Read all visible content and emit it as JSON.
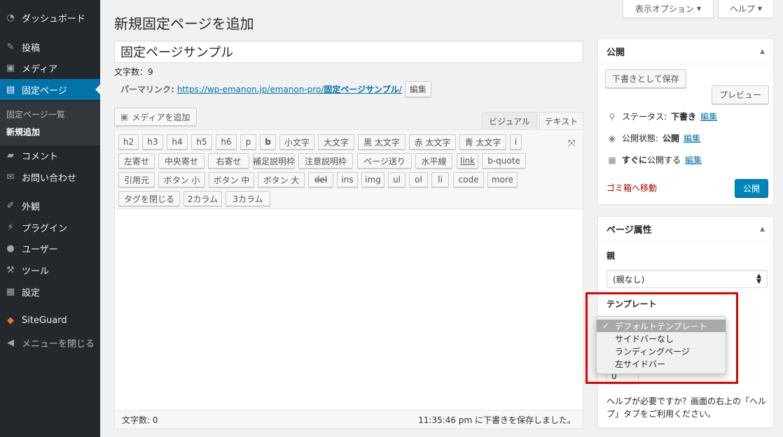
{
  "sidebar": {
    "items": [
      {
        "label": "ダッシュボード",
        "icon": "dashboard-icon",
        "glyph": "◔"
      },
      {
        "label": "投稿",
        "icon": "pin-icon",
        "glyph": "✎"
      },
      {
        "label": "メディア",
        "icon": "media-icon",
        "glyph": "▣"
      },
      {
        "label": "固定ページ",
        "icon": "page-icon",
        "glyph": "▤"
      },
      {
        "label": "コメント",
        "icon": "comment-icon",
        "glyph": "▰"
      },
      {
        "label": "お問い合わせ",
        "icon": "mail-icon",
        "glyph": "✉"
      },
      {
        "label": "外観",
        "icon": "brush-icon",
        "glyph": "✐"
      },
      {
        "label": "プラグイン",
        "icon": "plugin-icon",
        "glyph": "⚡"
      },
      {
        "label": "ユーザー",
        "icon": "user-icon",
        "glyph": "●"
      },
      {
        "label": "ツール",
        "icon": "wrench-icon",
        "glyph": "⚒"
      },
      {
        "label": "設定",
        "icon": "settings-icon",
        "glyph": "▦"
      },
      {
        "label": "SiteGuard",
        "icon": "siteguard-icon",
        "glyph": "◆"
      },
      {
        "label": "メニューを閉じる",
        "icon": "collapse-icon",
        "glyph": "◀"
      }
    ],
    "submenu": [
      "固定ページ一覧",
      "新規追加"
    ]
  },
  "screen_options": {
    "label": "表示オプション",
    "arrow": "▼"
  },
  "help": {
    "label": "ヘルプ",
    "arrow": "▼"
  },
  "page_title": "新規固定ページを追加",
  "post_title": "固定ページサンプル",
  "char_count_top": "文字数：9",
  "permalink": {
    "label": "パーマリンク:",
    "url_base": "https://wp-emanon.jp/emanon-pro/",
    "slug": "固定ページサンプル",
    "url_end": "/",
    "edit_label": "編集"
  },
  "media_button": "メディアを追加",
  "tabs": {
    "visual": "ビジュアル",
    "text": "テキスト"
  },
  "quicktags": {
    "row1": [
      "h2",
      "h3",
      "h4",
      "h5",
      "h6",
      "p",
      "b",
      "小文字",
      "大文字",
      "黒 太文字",
      "赤 太文字",
      "青 太文字",
      "i"
    ],
    "row2": [
      "左寄せ",
      "中央寄せ",
      "右寄せ",
      "補足説明枠",
      "注意説明枠",
      "ページ送り",
      "水平線",
      "link",
      "b-quote"
    ],
    "row3": [
      "引用元",
      "ボタン 小",
      "ボタン 中",
      "ボタン 大",
      "del",
      "ins",
      "img",
      "ul",
      "ol",
      "li",
      "code",
      "more"
    ],
    "row4": [
      "タグを閉じる",
      "2カラム",
      "3カラム"
    ]
  },
  "status_bar": {
    "word_count": "文字数: 0",
    "saved": "11:35:46 pm に下書きを保存しました。"
  },
  "publish_box": {
    "title": "公開",
    "save_draft": "下書きとして保存",
    "preview": "プレビュー",
    "status_label": "ステータス:",
    "status_value": "下書き",
    "visibility_label": "公開状態:",
    "visibility_value": "公開",
    "schedule_pre": "すぐに",
    "schedule_post": "公開する",
    "edit": "編集",
    "trash": "ゴミ箱へ移動",
    "publish": "公開"
  },
  "attributes_box": {
    "title": "ページ属性",
    "parent_label": "親",
    "parent_value": "(親なし)",
    "template_label": "テンプレート",
    "template_options": [
      "デフォルトテンプレート",
      "サイドバーなし",
      "ランディングページ",
      "左サイドバー"
    ],
    "selected_template": "デフォルトテンプレート",
    "order_value": "0",
    "help_text": "ヘルプが必要ですか？画面の右上の「ヘルプ」タブをご利用ください。"
  },
  "colors": {
    "accent": "#0073aa",
    "sidebar": "#23282d",
    "highlight": "#e00000",
    "trash": "#aa0000"
  }
}
